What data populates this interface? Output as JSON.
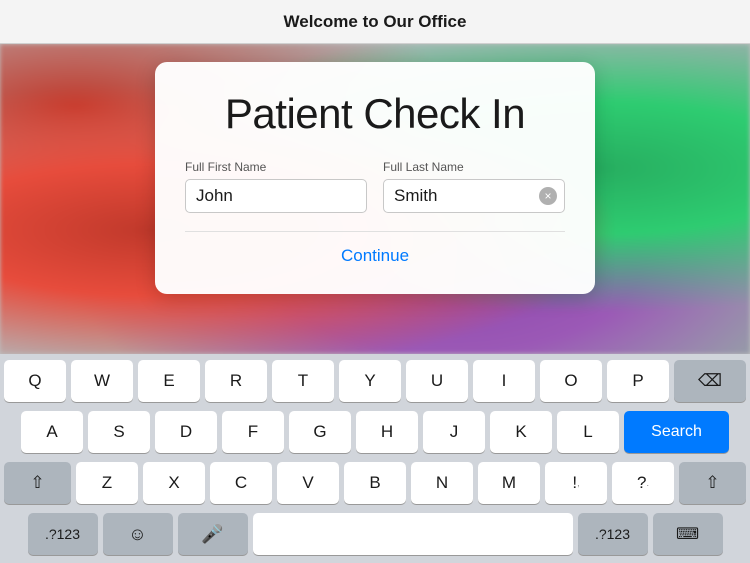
{
  "topBar": {
    "title": "Welcome to Our Office"
  },
  "card": {
    "title": "Patient Check In",
    "firstNameLabel": "Full First Name",
    "firstNameValue": "John",
    "lastNameLabel": "Full Last Name",
    "lastNameValue": "Smith",
    "continueLabel": "Continue"
  },
  "keyboard": {
    "rows": [
      [
        "Q",
        "W",
        "E",
        "R",
        "T",
        "Y",
        "U",
        "I",
        "O",
        "P"
      ],
      [
        "A",
        "S",
        "D",
        "F",
        "G",
        "H",
        "J",
        "K",
        "L"
      ],
      [
        "Z",
        "X",
        "C",
        "V",
        "B",
        "N",
        "M",
        "!",
        "?"
      ]
    ],
    "searchLabel": "Search",
    "numbersLabel": ".?123",
    "emojiLabel": "☺",
    "micLabel": "🎤",
    "spaceValue": ""
  }
}
